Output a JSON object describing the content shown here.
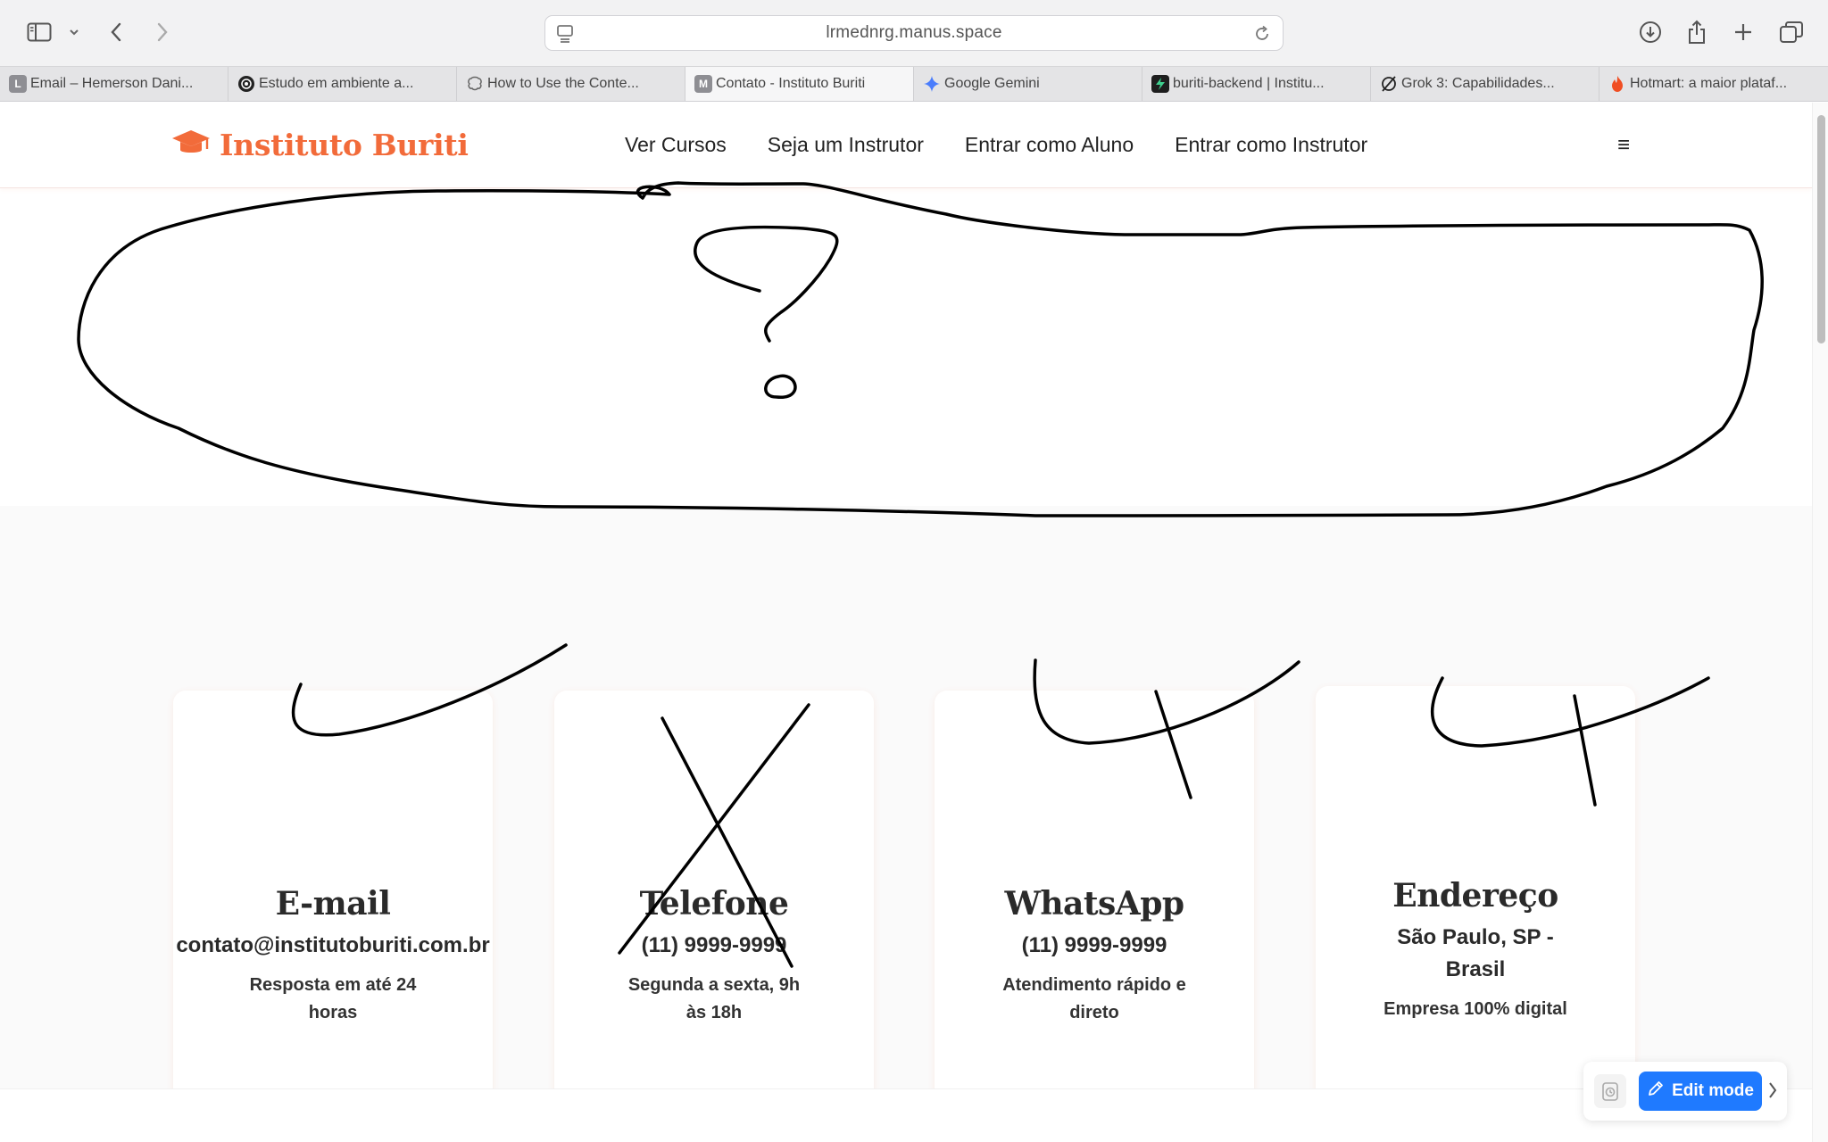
{
  "browser": {
    "url": "lrmednrg.manus.space",
    "tabs": [
      {
        "label": "Email – Hemerson Dani...",
        "favicon": "L",
        "color": "#8e8e93",
        "active": false
      },
      {
        "label": "Estudo em ambiente a...",
        "favicon": "openai-icon",
        "color": "#222222",
        "active": false
      },
      {
        "label": "How to Use the Conte...",
        "favicon": "brain-icon",
        "color": "#777777",
        "active": false
      },
      {
        "label": "Contato - Instituto Buriti",
        "favicon": "M",
        "color": "#8e8e93",
        "active": true
      },
      {
        "label": "Google Gemini",
        "favicon": "gemini-icon",
        "color": "#4a7dfc",
        "active": false
      },
      {
        "label": "buriti-backend | Institu...",
        "favicon": "bolt-icon",
        "color": "#1e1e1e",
        "active": false
      },
      {
        "label": "Grok 3: Capabilidades...",
        "favicon": "grok-icon",
        "color": "#222222",
        "active": false
      },
      {
        "label": "Hotmart: a maior plataf...",
        "favicon": "flame-icon",
        "color": "#f04e23",
        "active": false
      }
    ]
  },
  "site": {
    "brand": "Instituto Buriti",
    "brand_color": "#f26b3a",
    "nav": [
      "Ver Cursos",
      "Seja um Instrutor",
      "Entrar como Aluno",
      "Entrar como Instrutor"
    ],
    "menu_icon": "≡"
  },
  "contact_cards": [
    {
      "title": "E-mail",
      "value": "contato@institutoburiti.com.br",
      "note_line1": "Resposta em até 24",
      "note_line2": "horas"
    },
    {
      "title": "Telefone",
      "value": "(11) 9999-9999",
      "note_line1": "Segunda a sexta, 9h",
      "note_line2": "às 18h"
    },
    {
      "title": "WhatsApp",
      "value": "(11) 9999-9999",
      "note_line1": "Atendimento rápido e",
      "note_line2": "direto"
    },
    {
      "title": "Endereço",
      "value_line1": "São Paulo, SP -",
      "value_line2": "Brasil",
      "note_line1": "Empresa 100% digital"
    }
  ],
  "edit_widget": {
    "label": "Edit mode"
  }
}
